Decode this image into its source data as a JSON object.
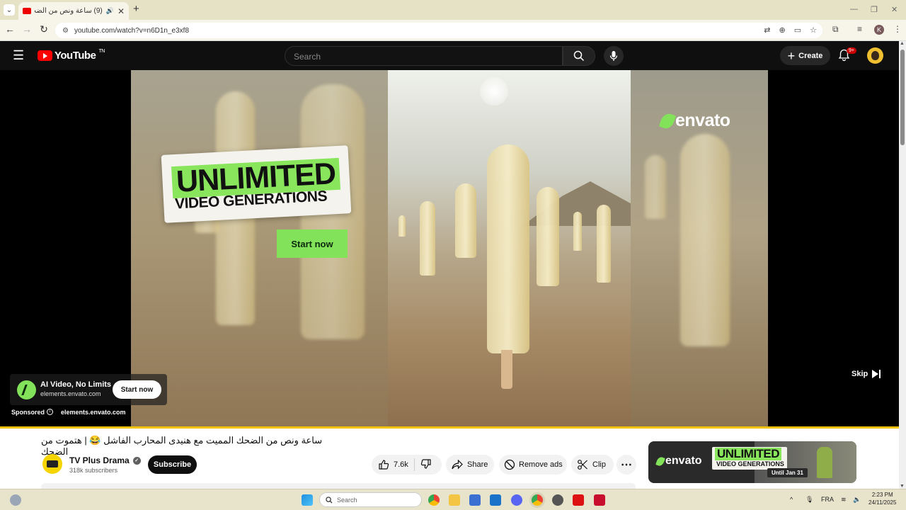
{
  "browser": {
    "tab_title": "(9) ساعة ونص من الضحك ال",
    "address": "youtube.com/watch?v=n6D1n_e3xf8"
  },
  "header": {
    "logo_text": "YouTube",
    "logo_country": "TN",
    "search_placeholder": "Search",
    "create_label": "Create",
    "notification_badge": "9+"
  },
  "ad": {
    "headline_1": "UNLIMITED",
    "headline_2": "VIDEO GENERATIONS",
    "cta_video": "Start now",
    "brand": "envato",
    "card_title": "AI Video, No Limits",
    "card_domain": "elements.envato.com",
    "card_cta": "Start now",
    "sponsored_label": "Sponsored",
    "sponsored_domain": "elements.envato.com",
    "skip_label": "Skip",
    "progress_fraction": 1.0
  },
  "video": {
    "title": "ساعة ونص من الضحك المميت مع هنيدى المحارب الفاشل 😂 | هتموت من الضحك",
    "channel_name": "TV Plus Drama",
    "subscribers": "318k subscribers",
    "subscribe_label": "Subscribe",
    "likes": "7.6k",
    "share_label": "Share",
    "remove_ads_label": "Remove ads",
    "clip_label": "Clip"
  },
  "side_ad": {
    "brand": "envato",
    "line_1": "UNLIMITED",
    "line_2": "VIDEO GENERATIONS",
    "until": "Until Jan 31"
  },
  "taskbar": {
    "search_placeholder": "Search",
    "language": "FRA",
    "time": "2:23 PM",
    "date": "24/11/2025"
  },
  "colors": {
    "youtube_red": "#ff0000",
    "envato_green": "#82e25a",
    "progress_yellow": "#f2c400"
  }
}
